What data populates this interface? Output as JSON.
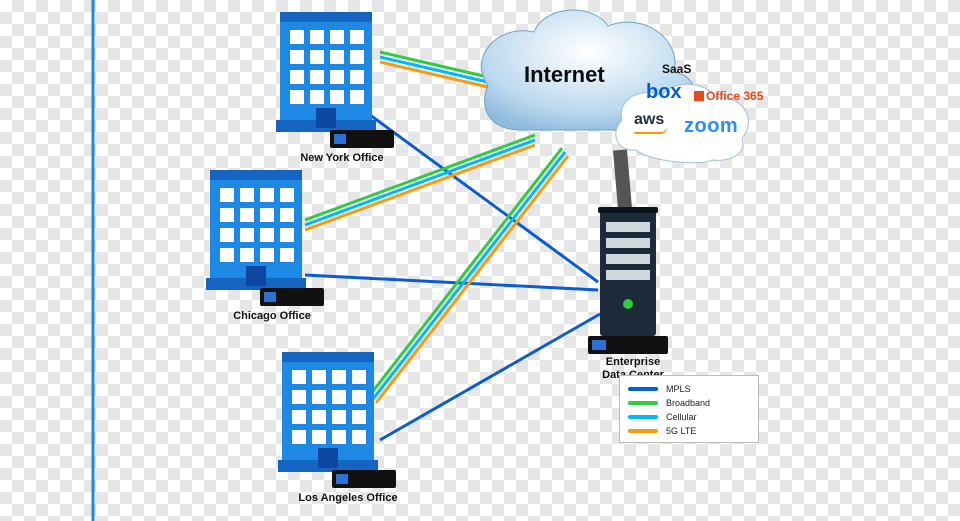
{
  "cloud": {
    "title": "Internet",
    "saas_label": "SaaS"
  },
  "vendors": {
    "box": "box",
    "office365": "Office 365",
    "aws": "aws",
    "zoom": "zoom"
  },
  "offices": {
    "ny": {
      "label": "New York Office"
    },
    "chi": {
      "label": "Chicago Office"
    },
    "la": {
      "label": "Los Angeles Office"
    }
  },
  "datacenter": {
    "label_line1": "Enterprise",
    "label_line2": "Data Center"
  },
  "legend": {
    "items": [
      {
        "label": "MPLS",
        "color": "#0a5bd6"
      },
      {
        "label": "Broadband",
        "color": "#2ecc40"
      },
      {
        "label": "Cellular",
        "color": "#00b7ff"
      },
      {
        "label": "5G LTE",
        "color": "#f39c12"
      }
    ]
  },
  "links": {
    "mpls_color": "#0a5bd6",
    "broadband_color": "#2ecc40",
    "cellular_color": "#00b7ff",
    "lte_color": "#f39c12"
  }
}
